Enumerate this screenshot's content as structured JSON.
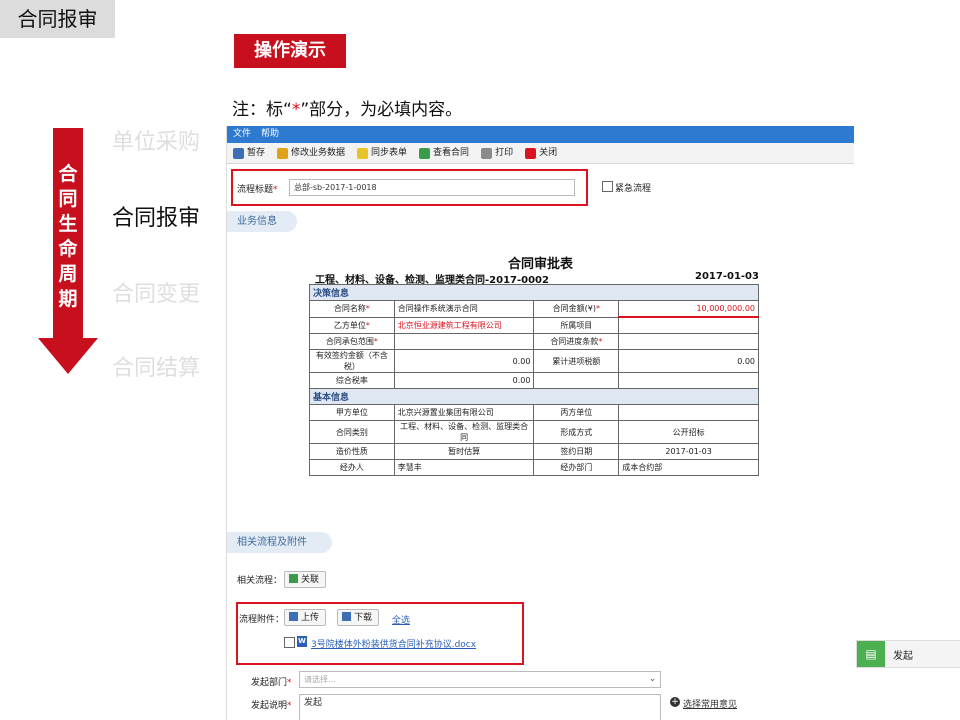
{
  "slide": {
    "title": "合同报审",
    "demo_label": "操作演示",
    "note_prefix": "注：标“",
    "note_star": "*",
    "note_suffix": "”部分，为必填内容。"
  },
  "lifecycle": {
    "arrow_text": [
      "合",
      "同",
      "生",
      "命",
      "周",
      "期"
    ],
    "stages": [
      "单位采购",
      "合同报审",
      "合同变更",
      "合同结算"
    ],
    "active_stage": "合同报审"
  },
  "menu": [
    "文件",
    "帮助"
  ],
  "toolbar": [
    {
      "label": "暂存",
      "icon": "save-icon"
    },
    {
      "label": "修改业务数据",
      "icon": "edit-data-icon"
    },
    {
      "label": "同步表单",
      "icon": "sync-icon"
    },
    {
      "label": "查看合同",
      "icon": "view-contract-icon"
    },
    {
      "label": "打印",
      "icon": "print-icon"
    },
    {
      "label": "关闭",
      "icon": "close-icon"
    }
  ],
  "process": {
    "title_label": "流程标题",
    "title_value": "总部-sb-2017-1-0018",
    "urgent_label": "紧急流程"
  },
  "sections": {
    "business_info": "业务信息",
    "related": "相关流程及附件"
  },
  "form": {
    "title": "合同审批表",
    "subtitle": "工程、材料、设备、检测、监理类合同-2017-0002",
    "date": "2017-01-03",
    "decision_header": "决策信息",
    "basic_header": "基本信息",
    "rows": {
      "contract_name_label": "合同名称",
      "contract_name_value": "合同操作系统演示合同",
      "amount_label": "合同金额(¥)",
      "amount_value": "10,000,000.00",
      "party_b_label": "乙方单位",
      "party_b_value": "北京恒业源建筑工程有限公司",
      "project_label": "所属项目",
      "scope_label": "合同承包范围",
      "progress_label": "合同进度条款",
      "effective_label": "有效签约金额（不含税）",
      "effective_value": "0.00",
      "cumulative_label": "累计进项税额",
      "cumulative_value": "0.00",
      "tax_rate_label": "综合税率",
      "tax_rate_value": "0.00",
      "party_a_label": "甲方单位",
      "party_a_value": "北京兴源置业集团有限公司",
      "party_c_label": "丙方单位",
      "category_label": "合同类别",
      "category_value": "工程、材料、设备、检测、监理类合同",
      "form_label": "形成方式",
      "form_value": "公开招标",
      "pricing_label": "造价性质",
      "pricing_value": "暂时估算",
      "sign_date_label": "签约日期",
      "sign_date_value": "2017-01-03",
      "handler_label": "经办人",
      "handler_value": "李慧丰",
      "handler_dept_label": "经办部门",
      "handler_dept_value": "成本合约部"
    }
  },
  "related": {
    "flow_label": "相关流程：",
    "associate_btn": "关联",
    "attach_label": "流程附件：",
    "upload_btn": "上传",
    "download_btn": "下载",
    "select_all": "全选",
    "file_name": "3号院楼体外粉装供货合同补充协议.docx"
  },
  "bottom": {
    "dept_label": "发起部门",
    "dept_placeholder": "请选择...",
    "desc_label": "发起说明",
    "desc_value": "发起",
    "common_opinion": "选择常用意见"
  },
  "side_panel": {
    "label": "发起"
  },
  "colors": {
    "accent_red": "#c80f1e",
    "menubar_blue": "#2e7ad1",
    "section_blue": "#dfe7f2"
  }
}
